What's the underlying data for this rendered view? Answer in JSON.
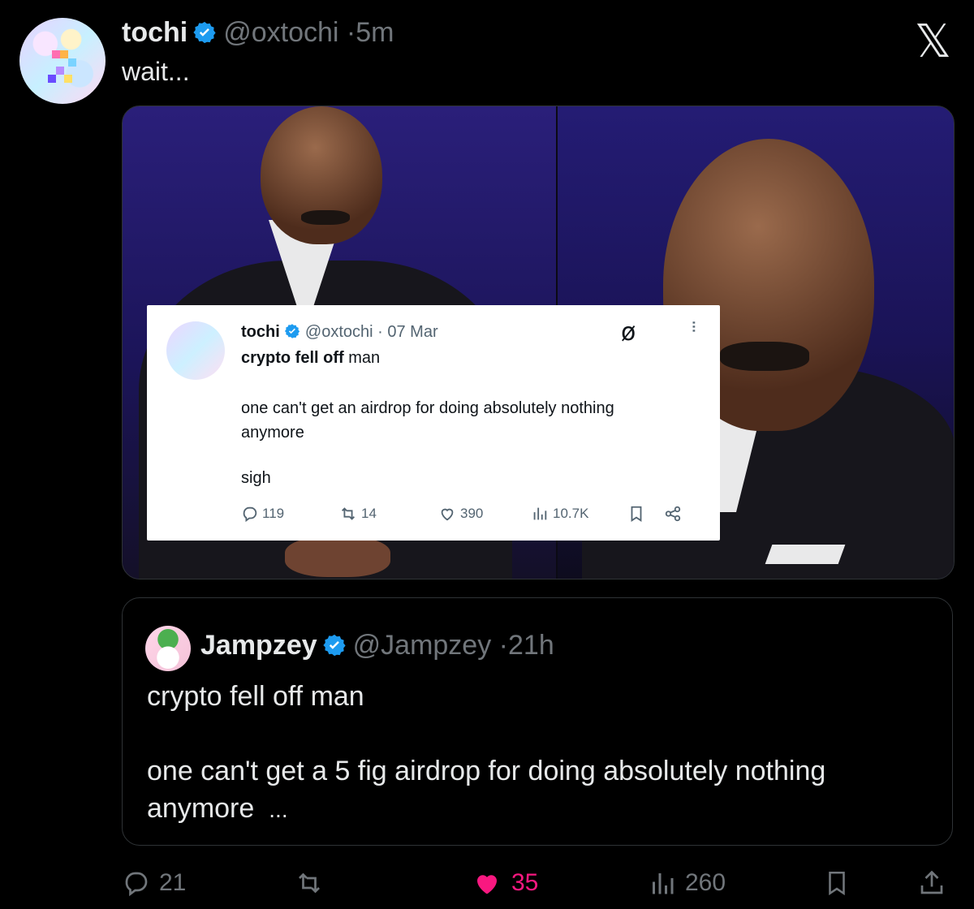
{
  "post": {
    "author_name": "tochi",
    "author_handle": "@oxtochi",
    "separator": "·",
    "time": "5m",
    "text": "wait..."
  },
  "brand_logo": "𝕏",
  "media_card": {
    "author_name": "tochi",
    "author_handle": "@oxtochi",
    "separator": "·",
    "date": "07 Mar",
    "title_bold": "crypto fell off",
    "title_rest": " man",
    "body": "one can't get an airdrop for doing absolutely nothing anymore",
    "sigh": "sigh",
    "replies": "119",
    "reposts": "14",
    "likes": "390",
    "views": "10.7K"
  },
  "quote": {
    "author_name": "Jampzey",
    "author_handle": "@Jampzey",
    "separator": "·",
    "time": "21h",
    "line1": "crypto fell off man",
    "body": "one can't get a 5 fig airdrop for doing absolutely nothing anymore",
    "ellipsis": "..."
  },
  "actions": {
    "replies": "21",
    "likes": "35",
    "views": "260"
  },
  "colors": {
    "background": "#000000",
    "text": "#e7e9ea",
    "muted": "#71767b",
    "verified": "#1d9bf0",
    "like": "#f91880"
  }
}
